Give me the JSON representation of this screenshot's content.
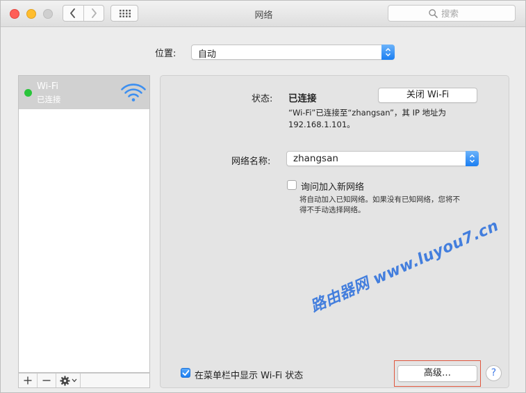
{
  "window": {
    "title": "网络"
  },
  "search": {
    "placeholder": "搜索"
  },
  "location": {
    "label": "位置:",
    "value": "自动"
  },
  "sidebar": {
    "items": [
      {
        "name": "Wi-Fi",
        "status": "已连接",
        "status_color": "#29c43a"
      }
    ]
  },
  "detail": {
    "status_label": "状态:",
    "status_value": "已连接",
    "toggle_wifi_label": "关闭 Wi-Fi",
    "info_line1": "“Wi-Fi”已连接至“zhangsan”，其 IP 地址为",
    "info_line2": "192.168.1.101。",
    "network_name_label": "网络名称:",
    "network_name_value": "zhangsan",
    "ask_join_label": "询问加入新网络",
    "ask_join_checked": false,
    "ask_join_help_line1": "将自动加入已知网络。如果没有已知网络，您将不",
    "ask_join_help_line2": "得不手动选择网络。"
  },
  "footer": {
    "show_in_menubar_label": "在菜单栏中显示 Wi-Fi 状态",
    "show_in_menubar_checked": true,
    "advanced_label": "高级…",
    "help_label": "?"
  },
  "watermark": {
    "text": "路由器网 www.luyou7.cn"
  },
  "colors": {
    "accent": "#1a7ef2",
    "highlight_box": "#e0553c",
    "watermark": "#3b79dd"
  }
}
